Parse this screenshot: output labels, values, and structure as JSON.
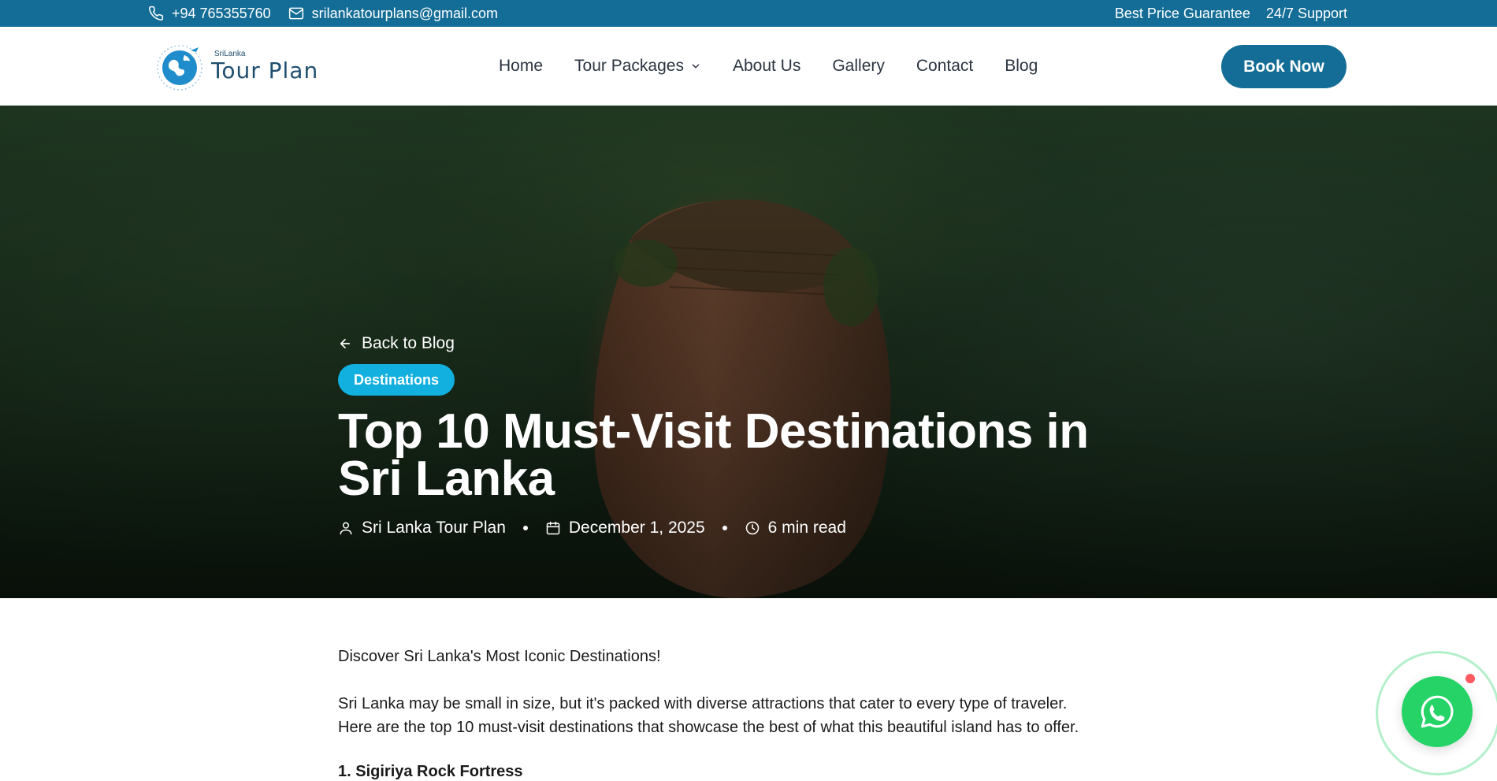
{
  "topbar": {
    "phone": "+94 765355760",
    "email": "srilankatourplans@gmail.com",
    "guarantee": "Best Price Guarantee",
    "support": "24/7 Support",
    "background": "#146d96"
  },
  "header": {
    "logo_small": "SriLanka",
    "logo_big": "Tour Plan",
    "nav": {
      "home": "Home",
      "tour_packages": "Tour Packages",
      "about": "About Us",
      "gallery": "Gallery",
      "contact": "Contact",
      "blog": "Blog"
    },
    "book_now": "Book Now"
  },
  "hero": {
    "back_label": "Back to Blog",
    "category": "Destinations",
    "title_line1": "Top 10 Must-Visit Destinations in",
    "title_line2": "Sri Lanka",
    "author": "Sri Lanka Tour Plan",
    "date": "December 1, 2025",
    "read_time": "6 min read",
    "badge_color": "#11b0df"
  },
  "article": {
    "intro": "Discover Sri Lanka's Most Iconic Destinations!",
    "para1_line1": "Sri Lanka may be small in size, but it's packed with diverse attractions that cater to every type of traveler.",
    "para1_line2": "Here are the top 10 must-visit destinations that showcase the best of what this beautiful island has to offer.",
    "heading1": "1. Sigiriya Rock Fortress"
  },
  "whatsapp": {
    "icon": "whatsapp-icon",
    "color": "#25d366"
  }
}
